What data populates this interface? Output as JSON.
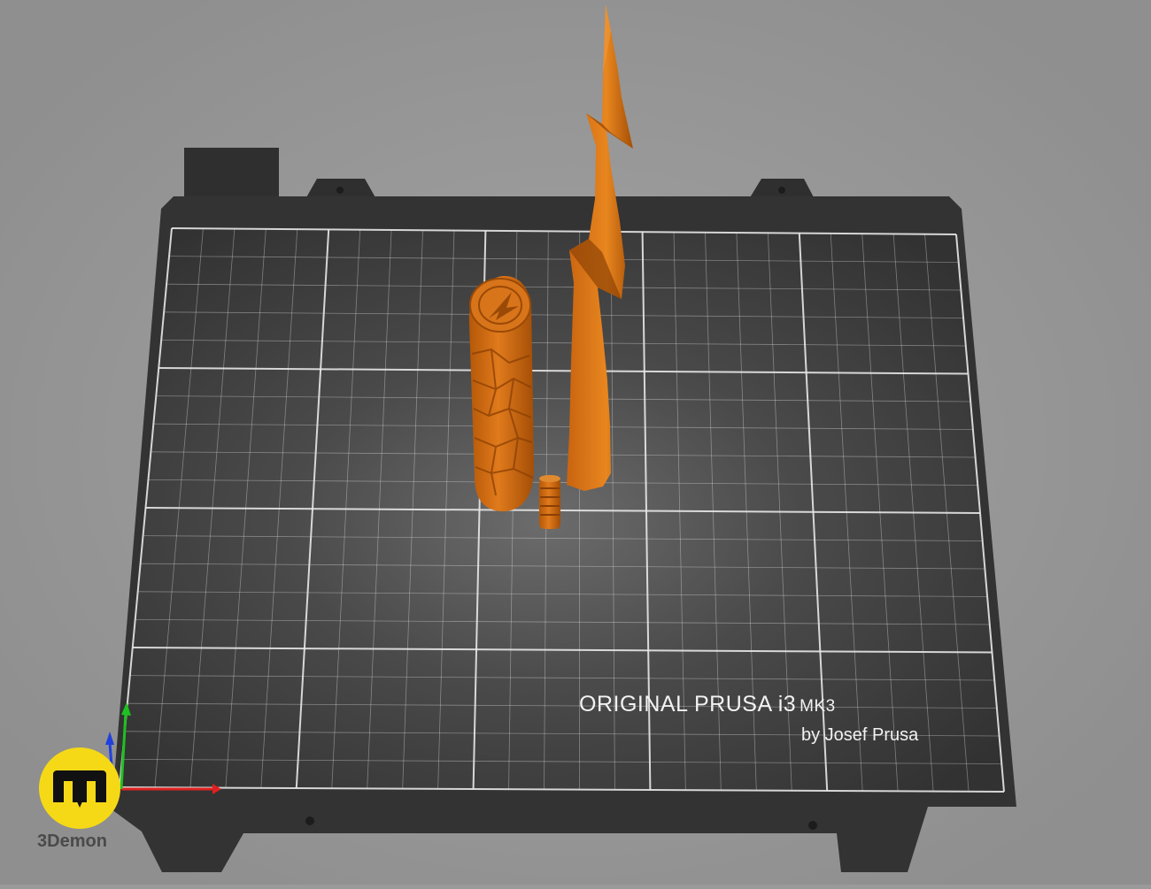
{
  "viewport": {
    "bed": {
      "model_label": "ORIGINAL PRUSA i3",
      "model_suffix": "MK3",
      "author_label": "by Josef Prusa"
    },
    "objects": [
      {
        "name": "textured-grip-handle",
        "color": "#cc6a12"
      },
      {
        "name": "lightning-bolt-spike",
        "color": "#cc6a12"
      },
      {
        "name": "small-connector-pin",
        "color": "#cc6a12"
      }
    ],
    "axes": {
      "x_color": "#e02020",
      "y_color": "#20c020",
      "z_color": "#2040e0"
    }
  },
  "watermark": {
    "name": "3Demon",
    "logo_icon": "3demon-logo-icon",
    "badge_color": "#f5d916"
  },
  "colors": {
    "background": "#9a9a9a",
    "bed_surface": "#3c3c3c",
    "grid_line": "#e8e8e8",
    "object_orange": "#cc6a12"
  }
}
